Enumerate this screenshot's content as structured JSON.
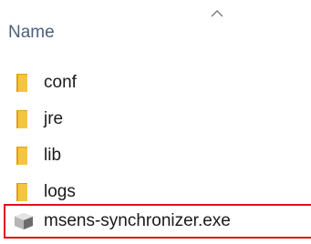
{
  "header": {
    "name_label": "Name",
    "sort_icon": "chevron-up-icon"
  },
  "files": [
    {
      "label": "conf",
      "type": "folder",
      "icon": "folder-icon"
    },
    {
      "label": "jre",
      "type": "folder",
      "icon": "folder-icon"
    },
    {
      "label": "lib",
      "type": "folder",
      "icon": "folder-icon"
    },
    {
      "label": "logs",
      "type": "folder",
      "icon": "folder-icon"
    },
    {
      "label": "msens-synchronizer.exe",
      "type": "application",
      "icon": "application-icon",
      "highlighted": true
    }
  ],
  "colors": {
    "folder": "#f5c542",
    "folder_dark": "#d9a21f",
    "highlight_border": "#e0101c",
    "header_text": "#4c607a"
  }
}
